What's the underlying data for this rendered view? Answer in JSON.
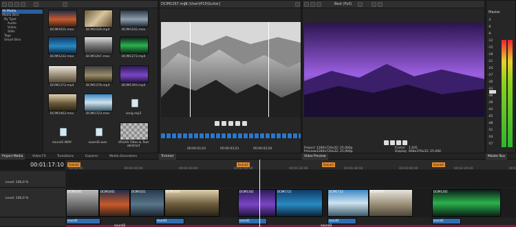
{
  "explorer": {
    "tree": [
      "All Media",
      "Media Bins",
      "By Type",
      "Audio",
      "Video",
      "Stills",
      "Tags",
      "Smart Bins"
    ],
    "items": [
      {
        "name": "DCIM1021.mov"
      },
      {
        "name": "DCIM1026.mp4"
      },
      {
        "name": "DCIM1102.mov"
      },
      {
        "name": "DCIM1232.mov"
      },
      {
        "name": "DCIM1267.mov"
      },
      {
        "name": "DCIM1273.mp4"
      },
      {
        "name": "DCIM1372.mp4"
      },
      {
        "name": "DCIM1378.mp4"
      },
      {
        "name": "DCIM1393.mp4"
      },
      {
        "name": "DCIM1463.mov"
      },
      {
        "name": "DCIM1723.mov"
      },
      {
        "name": "song.mp3"
      },
      {
        "name": "sound1.WAV"
      },
      {
        "name": "sound2.wav"
      },
      {
        "name": "VEGAS Titles & Text abstract"
      }
    ]
  },
  "trimmer": {
    "title": "DCIM1267.mov",
    "path": "[C:\\User\\IP15\\Guitar]",
    "time_in": "00:00:01;01",
    "time_out": "00:00:03;21",
    "time_len": "00:00:02;20"
  },
  "preview": {
    "quality": "Best (Full)",
    "project_label": "Project:",
    "project_value": "1280x720x32; 25,000p",
    "preview_label": "Preview:",
    "preview_value": "1280x720x32; 25,000p",
    "frame_label": "Frame:",
    "frame_value": "1.935",
    "display_label": "Display:",
    "display_value": "668x376x32; 25,000"
  },
  "master": {
    "title": "Master",
    "scale": [
      "-3",
      "-6",
      "-9",
      "-12",
      "-15",
      "-18",
      "-21",
      "-24",
      "-27",
      "-30",
      "-33",
      "-36",
      "-39",
      "-42",
      "-45",
      "-48",
      "-51",
      "-54",
      "-57"
    ],
    "left_level": 0.82,
    "right_level": 0.82
  },
  "tabs": [
    "Project Media",
    "Video FX",
    "Transitions",
    "Explorer",
    "Media Generators",
    "Trimmer",
    "Video Preview",
    "Master Bus"
  ],
  "timeline": {
    "timecode": "00:01:17:10",
    "ruler": [
      "00:00:00",
      "00:00:20:00",
      "00:00:40:00",
      "00:01:00:00",
      "00:01:20:00",
      "00:01:40:00",
      "00:02:00:00",
      "00:02:20:00",
      "00:02:40:00"
    ],
    "markers": [
      "Scene1",
      "Scene2",
      "Scene3",
      "Scene4"
    ],
    "track1_level": "Level: 100,0 %",
    "track2_level": "Level: 100,0 %",
    "clips": [
      "DCIM1463",
      "DCIM1602",
      "DCIM1021",
      "DCIM1463",
      "DCIM1302",
      "DCIM1722",
      "DCIM1723",
      "DCIM1467",
      "DCIM1302"
    ],
    "audio": [
      "sound1",
      "sound1",
      "sound1",
      "sound1",
      "sound1"
    ],
    "audio2": [
      "sound2",
      "sound2"
    ]
  }
}
